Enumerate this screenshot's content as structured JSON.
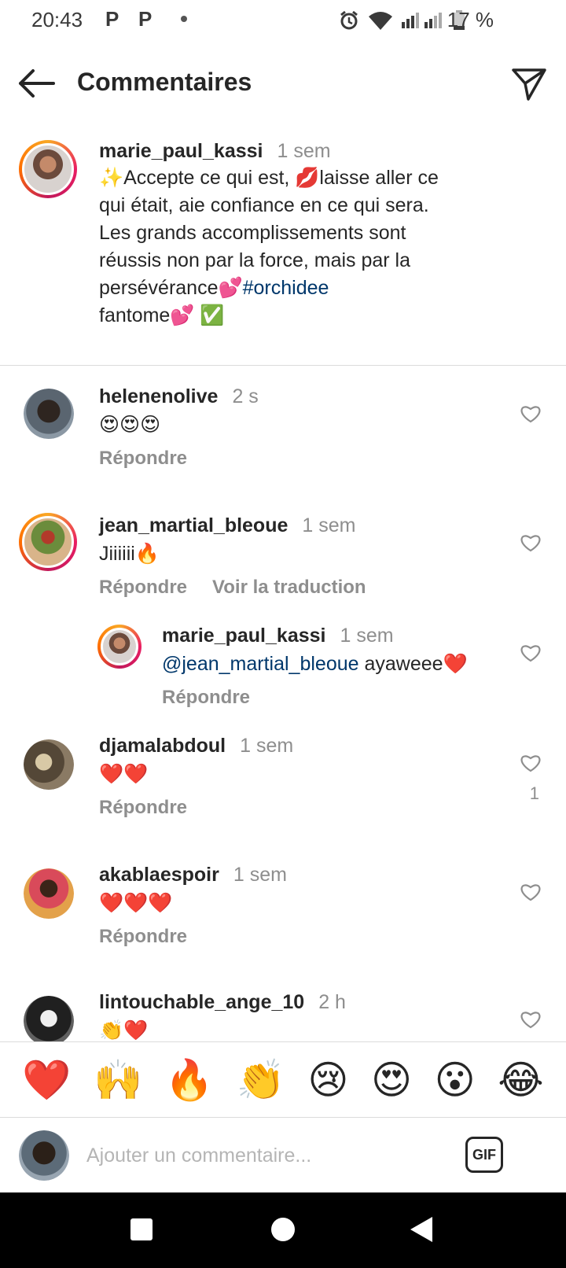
{
  "status_bar": {
    "time": "20:43",
    "notif_1": "P",
    "notif_2": "P",
    "battery": "17 %"
  },
  "header": {
    "title": "Commentaires",
    "back_icon": "arrow-left-icon",
    "share_icon": "paper-plane-icon"
  },
  "post": {
    "username": "marie_paul_kassi",
    "time": "1 sem",
    "text_1": "✨Accepte ce qui est, 💋laisse aller ce\nqui était, aie confiance en ce qui sera.\n Les grands accomplissements sont\nréussis non par la force, mais par la\npersévérance💕",
    "hashtag": "#orchidee",
    "text_2": "\nfantome💕 ✅"
  },
  "comments": [
    {
      "username": "helenenolive",
      "time": "2 s",
      "text": "😍😍😍",
      "reply": "Répondre"
    },
    {
      "username": "jean_martial_bleoue",
      "time": "1 sem",
      "text": "Jiiiiii🔥",
      "reply": "Répondre",
      "translate": "Voir la traduction",
      "replies": [
        {
          "username": "marie_paul_kassi",
          "time": "1 sem",
          "mention": "@jean_martial_bleoue",
          "text": " ayaweee❤️",
          "reply": "Répondre"
        }
      ]
    },
    {
      "username": "djamalabdoul",
      "time": "1 sem",
      "text": "❤️❤️",
      "reply": "Répondre",
      "likes": "1"
    },
    {
      "username": "akablaespoir",
      "time": "1 sem",
      "text": "❤️❤️❤️",
      "reply": "Répondre"
    },
    {
      "username": "lintouchable_ange_10",
      "time": "2 h",
      "text": "👏❤️"
    }
  ],
  "emoji_bar": [
    "❤️",
    "🙌",
    "🔥",
    "👏",
    "😢",
    "😍",
    "😮",
    "😂"
  ],
  "composer": {
    "placeholder": "Ajouter un commentaire...",
    "gif_label": "GIF"
  },
  "colors": {
    "text": "#262626",
    "secondary": "#8e8e8e",
    "link": "#00376b",
    "divider": "#dbdbdb"
  }
}
